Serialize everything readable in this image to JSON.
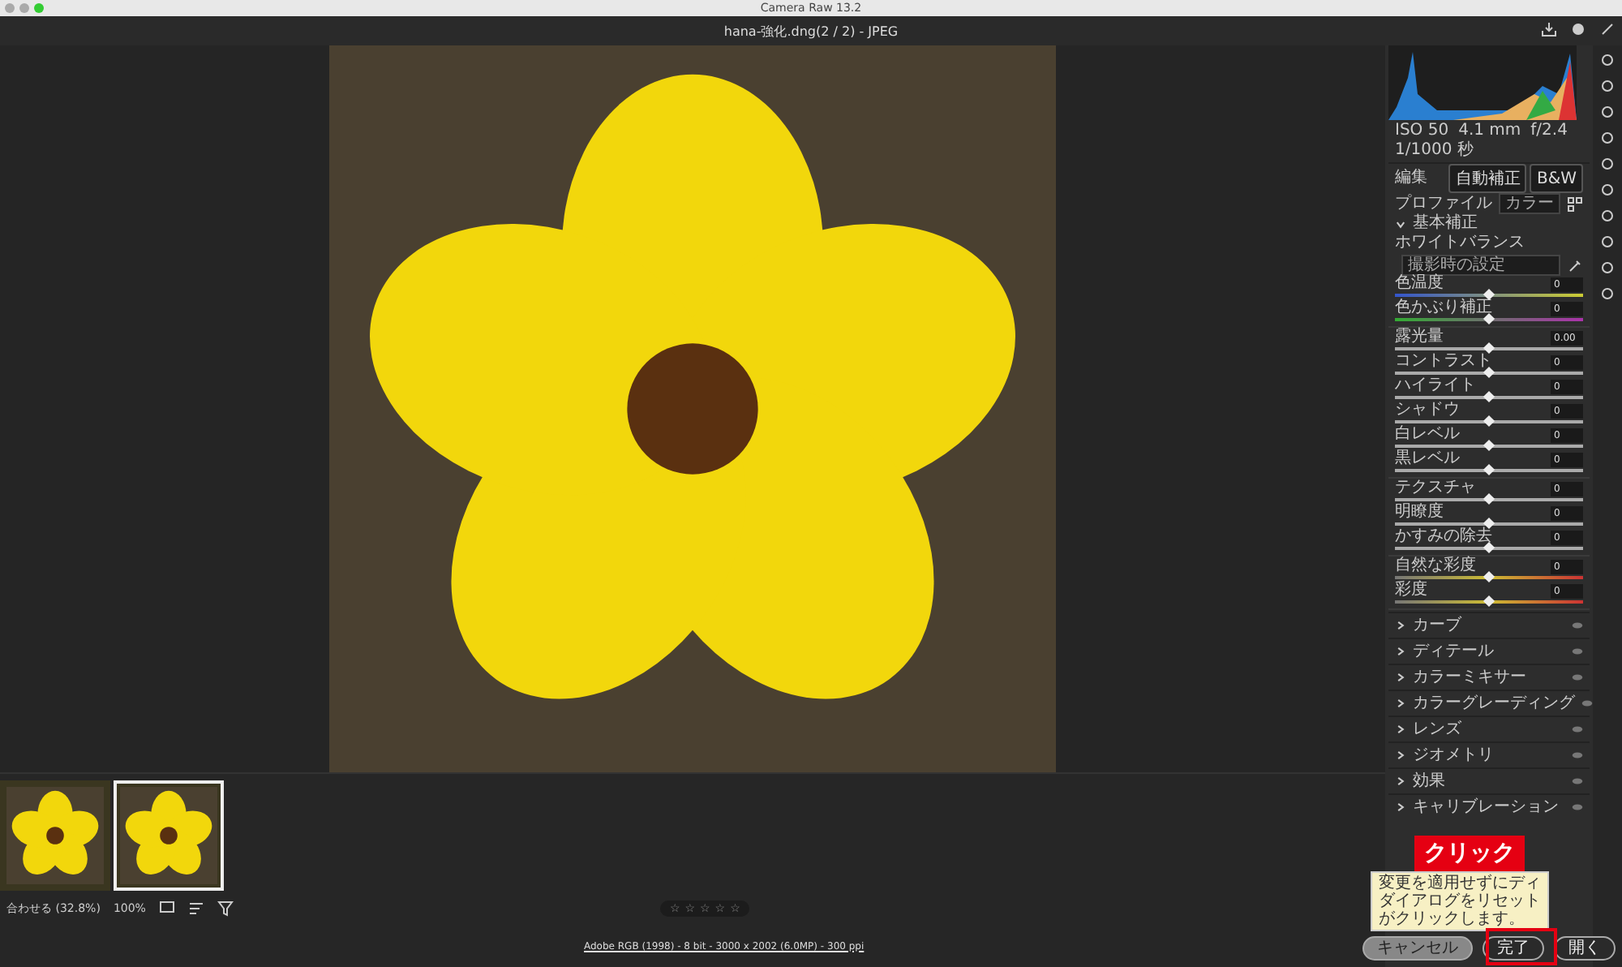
{
  "window": {
    "title": "Camera Raw 13.2"
  },
  "header": {
    "file": "hana-強化.dng(2 / 2)  -  JPEG"
  },
  "info": [
    "ISO 50",
    "4.1 mm",
    "f/2.4",
    "1/1000 秒"
  ],
  "edit": {
    "title": "編集",
    "buttons": [
      "自動補正",
      "B&W"
    ]
  },
  "profile": {
    "label": "プロファイル",
    "value": "カラー"
  },
  "basic": {
    "title": "基本補正",
    "expanded": true,
    "wb_label": "ホワイトバランス",
    "wb_value": "撮影時の設定",
    "groups": [
      [
        {
          "label": "色温度",
          "value": "0",
          "level": 0.5,
          "kind": "temp"
        },
        {
          "label": "色かぶり補正",
          "value": "0",
          "level": 0.5,
          "kind": "tint"
        }
      ],
      [
        {
          "label": "露光量",
          "value": "0.00",
          "level": 0.5,
          "kind": "plain"
        },
        {
          "label": "コントラスト",
          "value": "0",
          "level": 0.5,
          "kind": "plain"
        },
        {
          "label": "ハイライト",
          "value": "0",
          "level": 0.5,
          "kind": "plain"
        },
        {
          "label": "シャドウ",
          "value": "0",
          "level": 0.5,
          "kind": "plain"
        },
        {
          "label": "白レベル",
          "value": "0",
          "level": 0.5,
          "kind": "plain"
        },
        {
          "label": "黒レベル",
          "value": "0",
          "level": 0.5,
          "kind": "plain"
        }
      ],
      [
        {
          "label": "テクスチャ",
          "value": "0",
          "level": 0.5,
          "kind": "plain"
        },
        {
          "label": "明瞭度",
          "value": "0",
          "level": 0.5,
          "kind": "plain"
        },
        {
          "label": "かすみの除去",
          "value": "0",
          "level": 0.5,
          "kind": "plain"
        }
      ],
      [
        {
          "label": "自然な彩度",
          "value": "0",
          "level": 0.5,
          "kind": "color"
        },
        {
          "label": "彩度",
          "value": "0",
          "level": 0.5,
          "kind": "color"
        }
      ]
    ]
  },
  "sections": [
    {
      "title": "カーブ",
      "expanded": false
    },
    {
      "title": "ディテール",
      "expanded": false
    },
    {
      "title": "カラーミキサー",
      "expanded": false
    },
    {
      "title": "カラーグレーディング",
      "expanded": false
    },
    {
      "title": "レンズ",
      "expanded": false
    },
    {
      "title": "ジオメトリ",
      "expanded": false
    },
    {
      "title": "効果",
      "expanded": false
    },
    {
      "title": "キャリブレーション",
      "expanded": false
    }
  ],
  "filmstrip": [
    {
      "selected": false
    },
    {
      "selected": true
    }
  ],
  "toolbar": {
    "zoom_fit": "合わせる (32.8%)",
    "zoom": "100%",
    "stars": 0
  },
  "footer": {
    "info": "Adobe RGB (1998) - 8 bit - 3000 x 2002 (6.0MP) - 300 ppi"
  },
  "tooltip": [
    "変更を適用せずにディ",
    "ダイアログをリセット",
    "がクリックします。"
  ],
  "callout": "クリック",
  "buttons": {
    "cancel": "キャンセル",
    "done": "完了",
    "open": "開く"
  }
}
